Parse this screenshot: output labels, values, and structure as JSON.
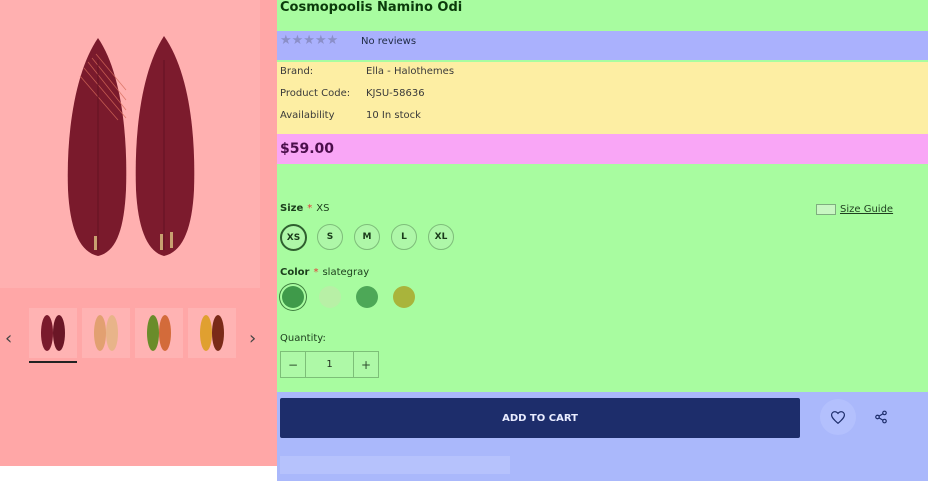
{
  "product": {
    "title": "Cosmopoolis Namino Odi",
    "stars": "★★★★★",
    "reviews_text": "No reviews",
    "brand_label": "Brand:",
    "brand_value": "Ella - Halothemes",
    "code_label": "Product Code:",
    "code_value": "KJSU-58636",
    "availability_label": "Availability",
    "availability_value": "10 In stock",
    "price": "$59.00"
  },
  "gallery": {
    "prev_arrow": "‹",
    "next_arrow": "›",
    "board_color": "#7a1a2c",
    "thumbnails": [
      {
        "colors": [
          "#7a1a2c",
          "#6b1626"
        ]
      },
      {
        "colors": [
          "#e2a071",
          "#e8b489"
        ]
      },
      {
        "colors": [
          "#6a8c2a",
          "#d36b3a"
        ]
      },
      {
        "colors": [
          "#e0a030",
          "#7a2a18"
        ]
      }
    ]
  },
  "options": {
    "size_label": "Size",
    "required_mark": "*",
    "size_selected": "XS",
    "size_guide": "Size Guide",
    "sizes": [
      "XS",
      "S",
      "M",
      "L",
      "XL"
    ],
    "color_label": "Color",
    "color_selected": "slategray",
    "colors": [
      "#3f9a4a",
      "#b8f0a6",
      "#4da857",
      "#a9b43b"
    ],
    "quantity_label": "Quantity:",
    "quantity_value": "1",
    "minus": "−",
    "plus": "+"
  },
  "actions": {
    "add_to_cart": "ADD TO CART"
  },
  "icons": {
    "wishlist": "heart-icon",
    "share": "share-icon",
    "size_guide": "ruler-icon"
  }
}
